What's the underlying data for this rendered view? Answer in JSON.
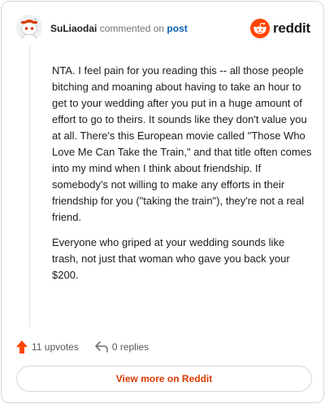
{
  "comment": {
    "username": "SuLiaodai",
    "action_text": "commented on",
    "post_link": "post",
    "paragraphs": [
      "NTA. I feel pain for you reading this -- all those people bitching and moaning about having to take an hour to get to your wedding after you put in a huge amount of effort to go to theirs. It sounds like they don't value you at all. There's this European movie called \"Those Who Love Me Can Take the Train,\" and that title often comes into my mind when I think about friendship. If somebody's not willing to make any efforts in their friendship for you (\"taking the train\"), they're not a real friend.",
      "Everyone who griped at your wedding sounds like trash, not just that woman who gave you back your $200."
    ]
  },
  "brand": {
    "name": "reddit",
    "icon": "reddit-logo-icon",
    "color": "#ff4500"
  },
  "footer": {
    "upvotes_label": "11 upvotes",
    "replies_label": "0 replies",
    "upvote_icon": "upvote-arrow-icon",
    "reply_icon": "reply-arrow-icon",
    "upvote_color": "#ff4500"
  },
  "view_more_label": "View more on Reddit"
}
